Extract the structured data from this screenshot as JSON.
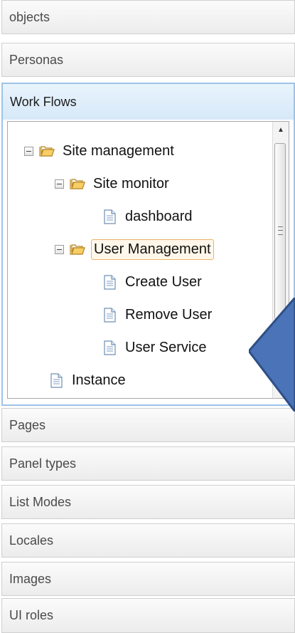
{
  "accordion": {
    "sections_above": [
      "objects",
      "Personas"
    ],
    "active_section": "Work Flows",
    "sections_below": [
      "Pages",
      "Panel types",
      "List Modes",
      "Locales",
      "Images",
      "UI roles"
    ]
  },
  "tree": {
    "root": "Site management",
    "site_monitor": "Site monitor",
    "dashboard": "dashboard",
    "user_management": "User Management",
    "create_user": "Create User",
    "remove_user": "Remove User",
    "user_service": "User Service",
    "instance": "Instance",
    "selected_node": "User Management"
  },
  "icons": {
    "folder": "open-folder-icon",
    "document": "document-icon",
    "collapse": "minus-toggle-icon"
  },
  "colors": {
    "active_border": "#9ec3e6",
    "selected_border": "#e8b36b",
    "arrow_fill": "#4a73b8"
  }
}
